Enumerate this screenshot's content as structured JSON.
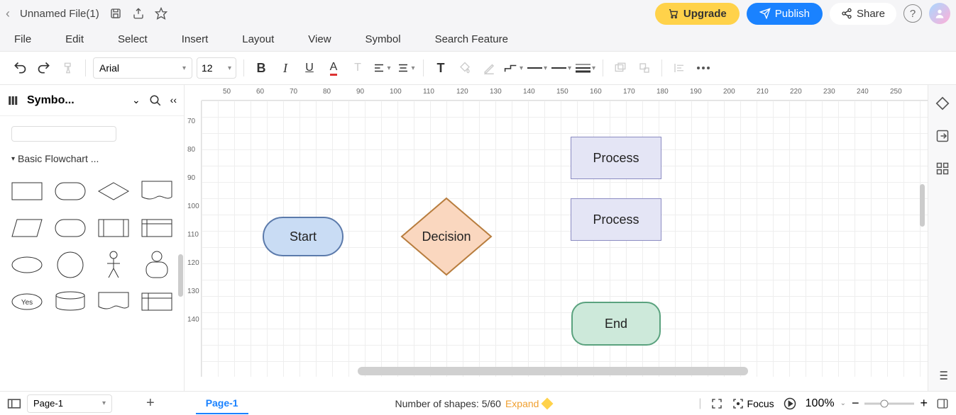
{
  "titlebar": {
    "filename": "Unnamed File(1)",
    "upgrade": "Upgrade",
    "publish": "Publish",
    "share": "Share"
  },
  "menu": {
    "file": "File",
    "edit": "Edit",
    "select": "Select",
    "insert": "Insert",
    "layout": "Layout",
    "view": "View",
    "symbol": "Symbol",
    "search_feature": "Search Feature"
  },
  "toolbar": {
    "font": "Arial",
    "font_size": "12"
  },
  "sidebar": {
    "title": "Symbo...",
    "category": "Basic Flowchart ..."
  },
  "shapes": {
    "start": "Start",
    "decision": "Decision",
    "process1": "Process",
    "process2": "Process",
    "end": "End"
  },
  "ruler_h": [
    "50",
    "60",
    "70",
    "80",
    "90",
    "100",
    "110",
    "120",
    "130",
    "140",
    "150",
    "160",
    "170",
    "180",
    "190",
    "200",
    "210",
    "220",
    "230",
    "240",
    "250"
  ],
  "ruler_v": [
    "70",
    "80",
    "90",
    "100",
    "110",
    "120",
    "130",
    "140"
  ],
  "bottombar": {
    "page_selector": "Page-1",
    "page_tab": "Page-1",
    "shapes_count": "Number of shapes: 5/60",
    "expand": "Expand",
    "focus": "Focus",
    "zoom": "100%"
  },
  "palette_shapes": {
    "yes_label": "Yes"
  }
}
